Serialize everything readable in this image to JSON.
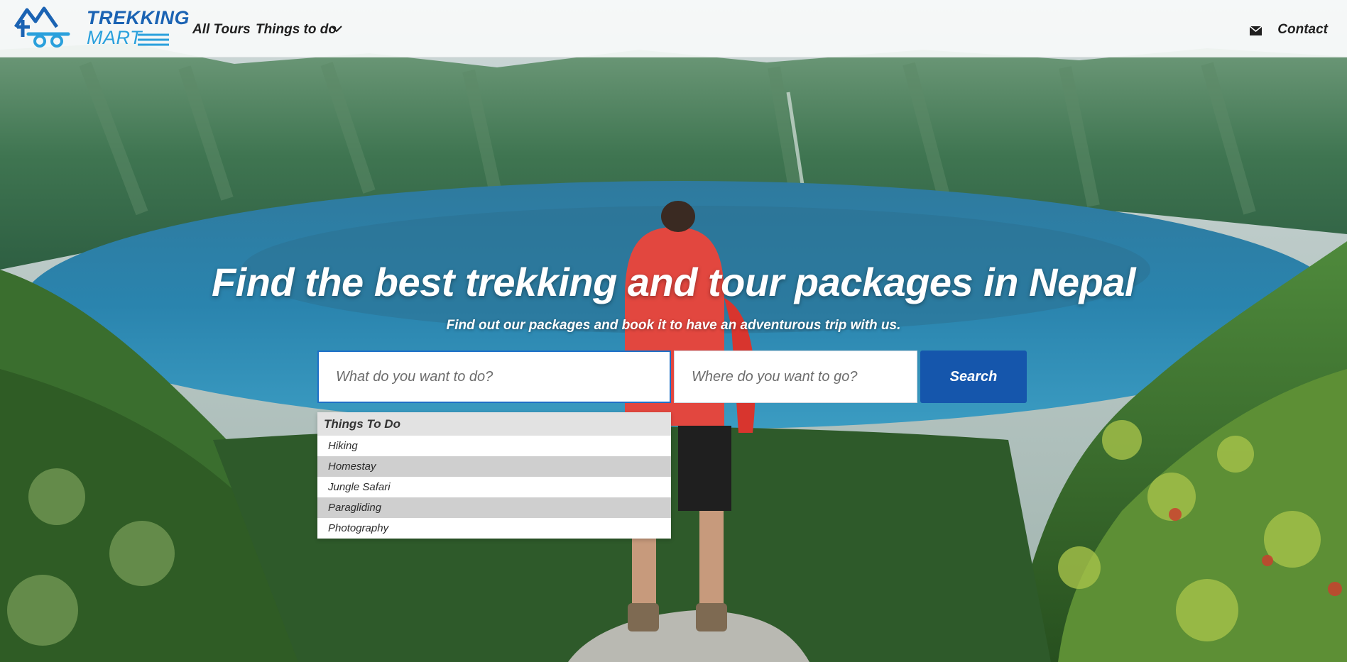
{
  "header": {
    "logo": {
      "line1": "TREKKING",
      "line2": "MART"
    },
    "nav": [
      {
        "label": "All Tours"
      },
      {
        "label": "Things to do"
      }
    ],
    "contact_label": "Contact"
  },
  "hero": {
    "title": "Find the best trekking and tour packages in Nepal",
    "subtitle": "Find out our packages and book it to have an adventurous trip with us."
  },
  "search": {
    "what_placeholder": "What do you want to do?",
    "where_placeholder": "Where do you want to go?",
    "button_label": "Search"
  },
  "dropdown": {
    "header": "Things To Do",
    "items": [
      {
        "label": "Hiking"
      },
      {
        "label": "Homestay"
      },
      {
        "label": "Jungle Safari"
      },
      {
        "label": "Paragliding"
      },
      {
        "label": "Photography"
      }
    ]
  },
  "colors": {
    "brand_dark": "#1b63b3",
    "brand_light": "#2aa0dc",
    "search_button": "#1556ac"
  }
}
